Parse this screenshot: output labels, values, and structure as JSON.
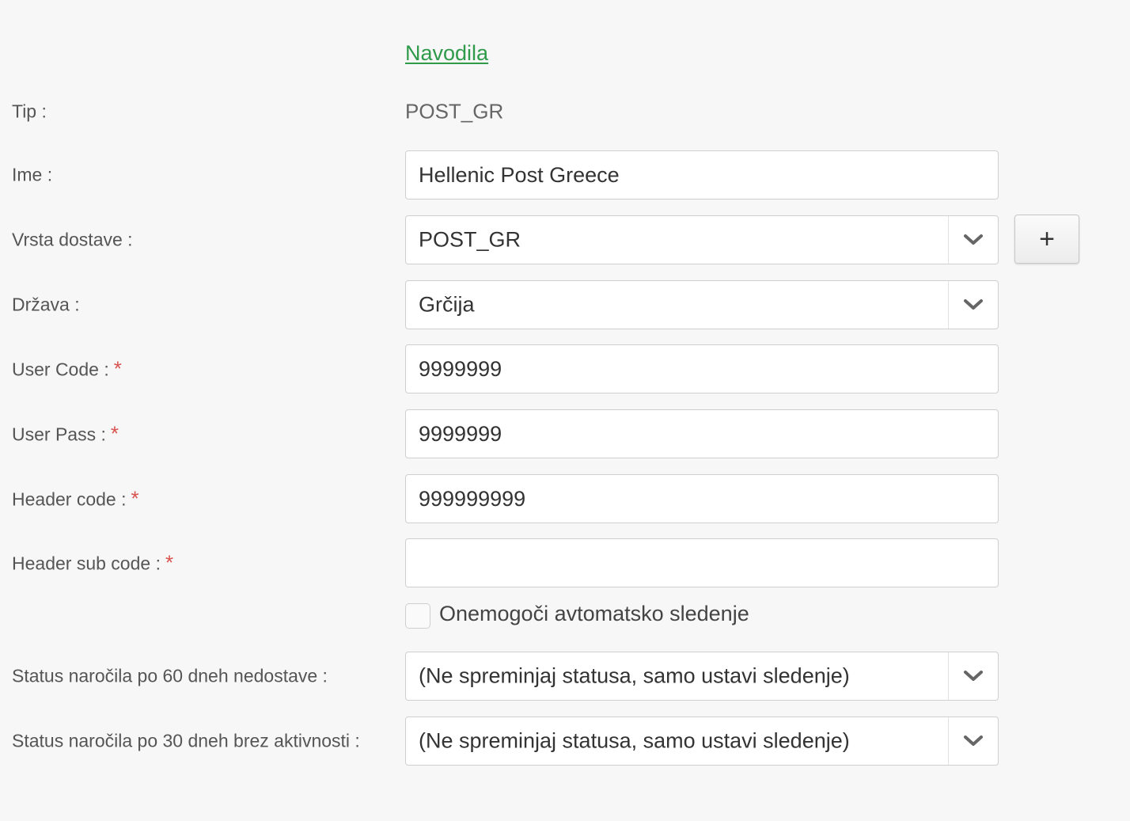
{
  "instructions_link": "Navodila",
  "fields": {
    "tip": {
      "label": "Tip :",
      "value": "POST_GR"
    },
    "ime": {
      "label": "Ime :",
      "value": "Hellenic Post Greece"
    },
    "vrsta_dostave": {
      "label": "Vrsta dostave :",
      "value": "POST_GR",
      "add_label": "+"
    },
    "drzava": {
      "label": "Država :",
      "value": "Grčija"
    },
    "user_code": {
      "label": "User Code :",
      "value": "9999999",
      "required": "*"
    },
    "user_pass": {
      "label": "User Pass :",
      "value": "9999999",
      "required": "*"
    },
    "header_code": {
      "label": "Header code :",
      "value": "999999999",
      "required": "*"
    },
    "header_sub_code": {
      "label": "Header sub code :",
      "value": "",
      "required": "*"
    },
    "disable_tracking": {
      "label": "Onemogoči avtomatsko sledenje",
      "checked": false
    },
    "status_60": {
      "label": "Status naročila po 60 dneh nedostave :",
      "value": "(Ne spreminjaj statusa, samo ustavi sledenje)"
    },
    "status_30": {
      "label": "Status naročila po 30 dneh brez aktivnosti :",
      "value": "(Ne spreminjaj statusa, samo ustavi sledenje)"
    }
  },
  "colors": {
    "link": "#2e9a4a",
    "required": "#d9534f",
    "background": "#f7f7f7"
  }
}
